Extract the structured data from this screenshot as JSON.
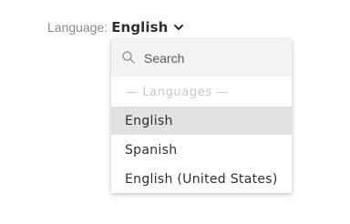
{
  "language_selector": {
    "label": "Language:",
    "selected": "English",
    "chevron_icon": "chevron-down-icon"
  },
  "dropdown": {
    "search": {
      "placeholder": "Search",
      "value": "",
      "icon": "search-icon"
    },
    "group_header": "— Languages —",
    "options": [
      {
        "label": "English",
        "highlighted": true
      },
      {
        "label": "Spanish",
        "highlighted": false
      },
      {
        "label": "English (United States)",
        "highlighted": false
      }
    ],
    "colors": {
      "highlight_bg": "#e1e1e1",
      "search_bg": "#f3f3f3",
      "group_header_text": "#c7c7c7"
    }
  }
}
